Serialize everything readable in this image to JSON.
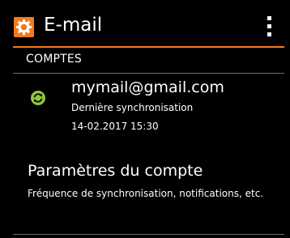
{
  "app_bar": {
    "title": "E-mail",
    "app_icon": "gear-icon",
    "menu_icon": "overflow-menu-icon"
  },
  "colors": {
    "accent": "#f37a1f",
    "sync_green": "#8dc63f",
    "background": "#000000",
    "divider": "#6b6b6b"
  },
  "accounts_section": {
    "header": "COMPTES",
    "account": {
      "email": "mymail@gmail.com",
      "sync_label": "Dernière synchronisation",
      "sync_time": "14-02.2017 15:30",
      "icon": "sync-icon"
    }
  },
  "settings": {
    "title": "Paramètres du compte",
    "subtitle": "Fréquence de synchronisation, notifications, etc."
  }
}
